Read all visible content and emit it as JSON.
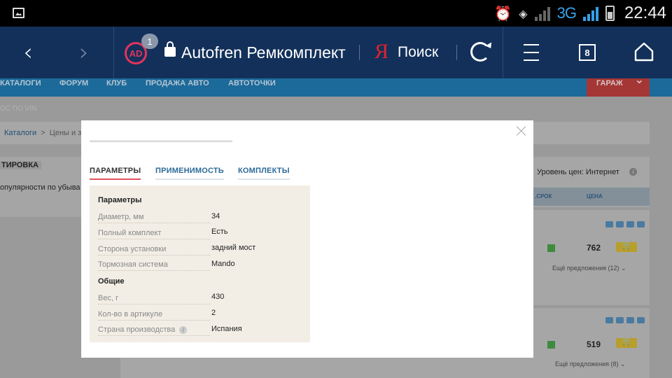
{
  "statusbar": {
    "network": "3G",
    "time": "22:44"
  },
  "browser": {
    "adblock_label": "AD",
    "adblock_count": "1",
    "url_title": "Autofren Ремкомплект",
    "yandex_logo": "Я",
    "search_label": "Поиск",
    "tab_count": "8"
  },
  "site": {
    "nav": [
      "КАТАЛОГИ",
      "ФОРУМ",
      "КЛУБ",
      "ПРОДАЖА АВТО",
      "АВТОТОЧКИ"
    ],
    "garage": "ГАРАЖ",
    "vin": "ОС ПО VIN",
    "breadcrumb": {
      "link": "Каталоги",
      "sep": ">",
      "rest": "Цены и за"
    },
    "sort_title": "ТИРОВКА",
    "sort_text": "опулярности по убыва",
    "price_level": "Уровень цен: Интернет",
    "table_headers": {
      "term": ".СРОК",
      "price": "ЦЕНА"
    },
    "rows": [
      {
        "price": "762",
        "more": "Ещё предложения (12)"
      },
      {
        "price": "519",
        "more": "Ещё предложения (8)"
      }
    ]
  },
  "modal": {
    "tabs": [
      "ПАРАМЕТРЫ",
      "ПРИМЕНИМОСТЬ",
      "КОМПЛЕКТЫ"
    ],
    "groups": [
      {
        "title": "Параметры",
        "params": [
          {
            "label": "Диаметр, мм",
            "value": "34"
          },
          {
            "label": "Полный комплект",
            "value": "Есть"
          },
          {
            "label": "Сторона установки",
            "value": "задний мост"
          },
          {
            "label": "Тормозная система",
            "value": "Mando"
          }
        ]
      },
      {
        "title": "Общие",
        "params": [
          {
            "label": "Вес, г",
            "value": "430"
          },
          {
            "label": "Кол-во в артикуле",
            "value": "2"
          },
          {
            "label": "Страна производства",
            "value": "Испания"
          }
        ]
      }
    ]
  },
  "colors": {
    "browser_bar": "#12305a",
    "active_tab_underline": "#e0535a",
    "link_blue": "#2c6a98",
    "params_bg": "#f2eee6"
  }
}
